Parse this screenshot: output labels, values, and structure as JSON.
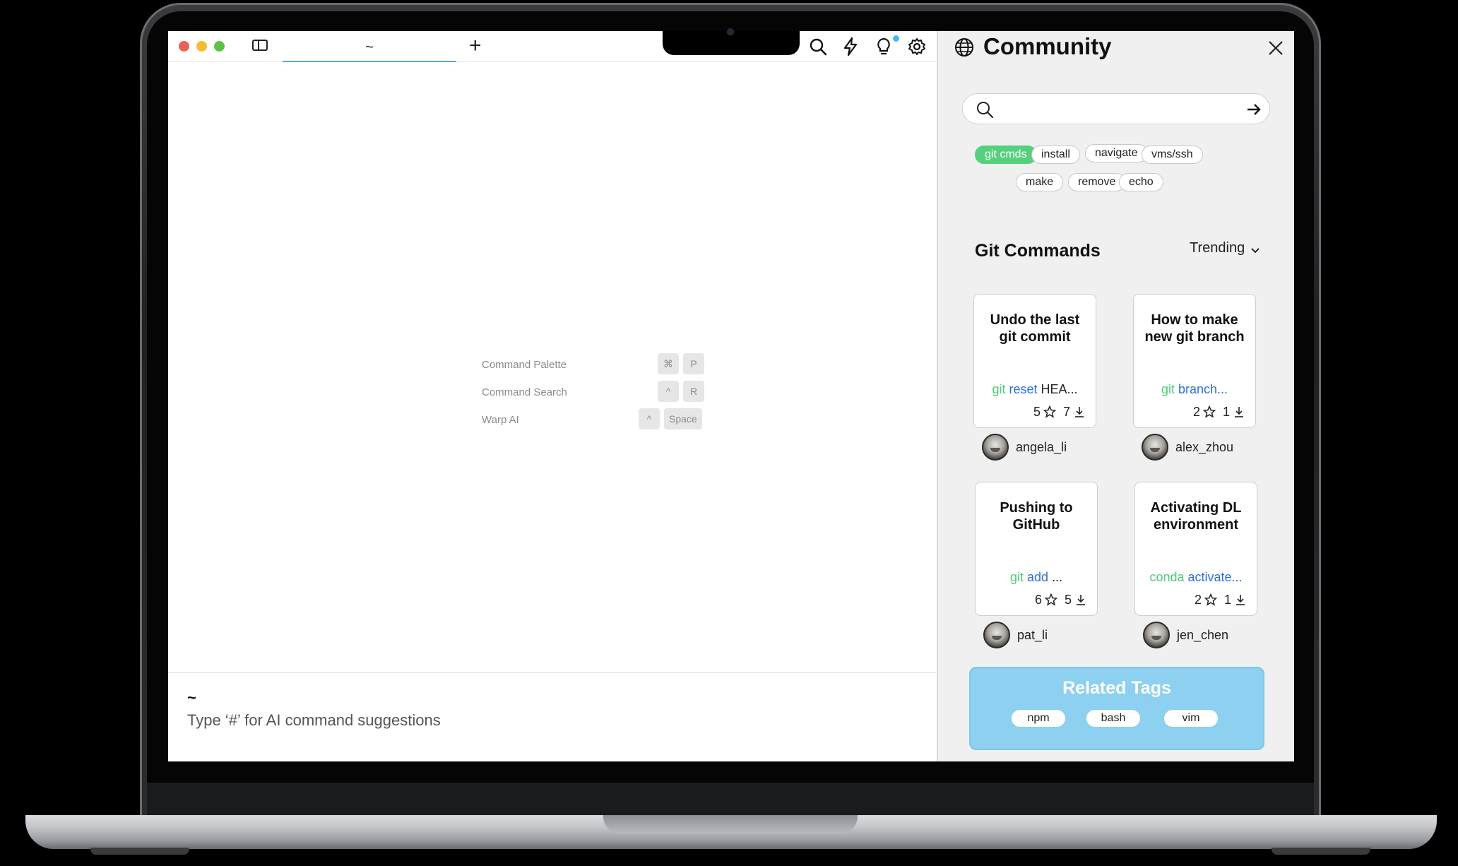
{
  "terminal": {
    "tab_label": "~",
    "new_tab_label": "+",
    "shortcuts": [
      {
        "label": "Command Palette",
        "keys": [
          "⌘",
          "P"
        ]
      },
      {
        "label": "Command Search",
        "keys": [
          "^",
          "R"
        ]
      },
      {
        "label": "Warp AI",
        "keys": [
          "^",
          "Space"
        ]
      }
    ],
    "prompt": {
      "tilde": "~",
      "hint": "Type ‘#’ for AI command suggestions"
    },
    "toolbar_icons": [
      "search-icon",
      "lightning-icon",
      "lightbulb-icon",
      "gear-icon"
    ]
  },
  "community": {
    "title": "Community",
    "search": {
      "placeholder": "",
      "value": ""
    },
    "tags": [
      "git cmds",
      "install",
      "navigate",
      "vms/ssh",
      "make",
      "remove",
      "echo"
    ],
    "active_tag": "git cmds",
    "section_title": "Git Commands",
    "sort_label": "Trending",
    "cards": [
      {
        "title": "Undo the last git commit",
        "cmd": [
          "git",
          "reset",
          "HEA..."
        ],
        "stars": "5",
        "downloads": "7",
        "author": "angela_li"
      },
      {
        "title": "How to make new git branch",
        "cmd": [
          "git",
          "branch...",
          ""
        ],
        "stars": "2",
        "downloads": "1",
        "author": "alex_zhou"
      },
      {
        "title": "Pushing to GitHub",
        "cmd": [
          "git",
          "add",
          "..."
        ],
        "stars": "6",
        "downloads": "5",
        "author": "pat_li"
      },
      {
        "title": "Activating  DL environment",
        "cmd": [
          "conda",
          "activate...",
          ""
        ],
        "stars": "2",
        "downloads": "1",
        "author": "jen_chen"
      }
    ],
    "related": {
      "title": "Related Tags",
      "tags": [
        "npm",
        "bash",
        "vim"
      ]
    }
  },
  "colors": {
    "active_tag": "#55d17e",
    "related_bg": "#8dd0f0",
    "token_green": "#4ccb7a",
    "token_blue": "#2f6fdb",
    "tab_underline": "#5aa8e8"
  }
}
